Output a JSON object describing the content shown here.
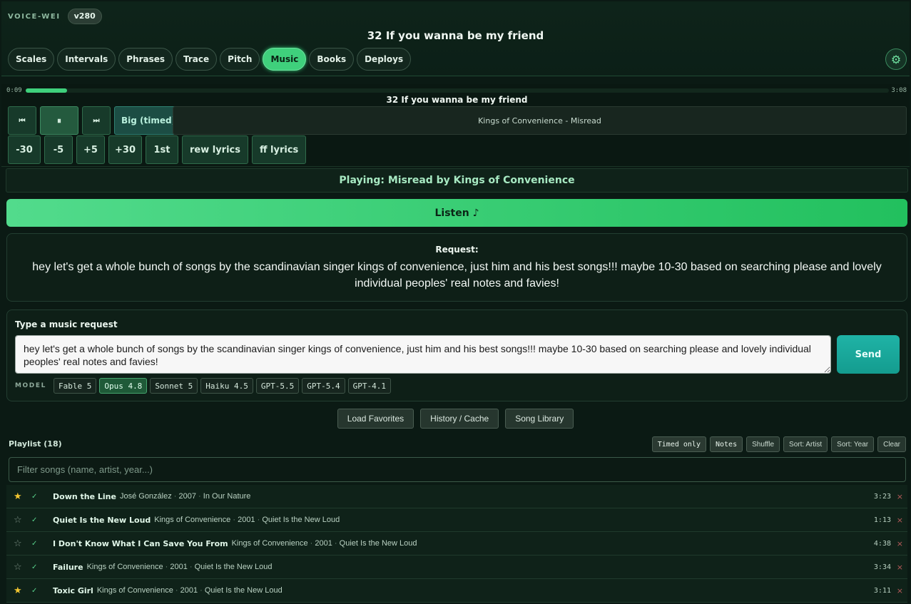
{
  "app": {
    "brand": "VOICE-WEI",
    "version": "v280",
    "now_title": "32 If you wanna be my friend"
  },
  "nav": {
    "tabs": [
      {
        "label": "Scales",
        "active": false
      },
      {
        "label": "Intervals",
        "active": false
      },
      {
        "label": "Phrases",
        "active": false
      },
      {
        "label": "Trace",
        "active": false
      },
      {
        "label": "Pitch",
        "active": false
      },
      {
        "label": "Music",
        "active": true
      },
      {
        "label": "Books",
        "active": false
      },
      {
        "label": "Deploys",
        "active": false
      }
    ],
    "settings_icon": "gear-icon"
  },
  "player": {
    "elapsed": "0:09",
    "total": "3:08",
    "progress_fraction": 0.048,
    "title": "32 If you wanna be my friend",
    "prev_icon": "⏮",
    "pause_icon": "⏸",
    "next_icon": "⏭",
    "big_label": "Big (timed)",
    "track_info": "Kings of Convenience - Misread",
    "seek_buttons": [
      "-30",
      "-5",
      "+5",
      "+30",
      "1st",
      "rew lyrics",
      "ff lyrics"
    ]
  },
  "status": {
    "text": "Playing: Misread by Kings of Convenience"
  },
  "listen": {
    "label": "Listen ♪"
  },
  "request": {
    "label": "Request:",
    "text": "hey let's get a whole bunch of songs by the scandinavian singer kings of convenience, just him and his best songs!!! maybe 10-30 based on searching please and lovely individual peoples' real notes and favies!"
  },
  "input": {
    "label": "Type a music request",
    "value": "hey let's get a whole bunch of songs by the scandinavian singer kings of convenience, just him and his best songs!!! maybe 10-30 based on searching please and lovely individual peoples' real notes and favies!",
    "send_label": "Send",
    "model_label": "MODEL",
    "models": [
      {
        "label": "Fable 5",
        "active": false
      },
      {
        "label": "Opus 4.8",
        "active": true
      },
      {
        "label": "Sonnet 5",
        "active": false
      },
      {
        "label": "Haiku 4.5",
        "active": false
      },
      {
        "label": "GPT-5.5",
        "active": false
      },
      {
        "label": "GPT-5.4",
        "active": false
      },
      {
        "label": "GPT-4.1",
        "active": false
      }
    ]
  },
  "actions": [
    "Load Favorites",
    "History / Cache",
    "Song Library"
  ],
  "playlist": {
    "title": "Playlist (18)",
    "tools": [
      "Timed only",
      "Notes",
      "Shuffle",
      "Sort: Artist",
      "Sort: Year",
      "Clear"
    ],
    "filter_placeholder": "Filter songs (name, artist, year...)",
    "songs": [
      {
        "fav": true,
        "title": "Down the Line",
        "artist": "José González",
        "year": "2007",
        "album": "In Our Nature",
        "duration": "3:23"
      },
      {
        "fav": false,
        "title": "Quiet Is the New Loud",
        "artist": "Kings of Convenience",
        "year": "2001",
        "album": "Quiet Is the New Loud",
        "duration": "1:13"
      },
      {
        "fav": false,
        "title": "I Don't Know What I Can Save You From",
        "artist": "Kings of Convenience",
        "year": "2001",
        "album": "Quiet Is the New Loud",
        "duration": "4:38"
      },
      {
        "fav": false,
        "title": "Failure",
        "artist": "Kings of Convenience",
        "year": "2001",
        "album": "Quiet Is the New Loud",
        "duration": "3:34"
      },
      {
        "fav": true,
        "title": "Toxic Girl",
        "artist": "Kings of Convenience",
        "year": "2001",
        "album": "Quiet Is the New Loud",
        "duration": "3:11"
      }
    ]
  },
  "colors": {
    "accent": "#3fd07c",
    "send": "#1fb3a6",
    "star": "#f2c531",
    "remove": "#b85a5a"
  }
}
